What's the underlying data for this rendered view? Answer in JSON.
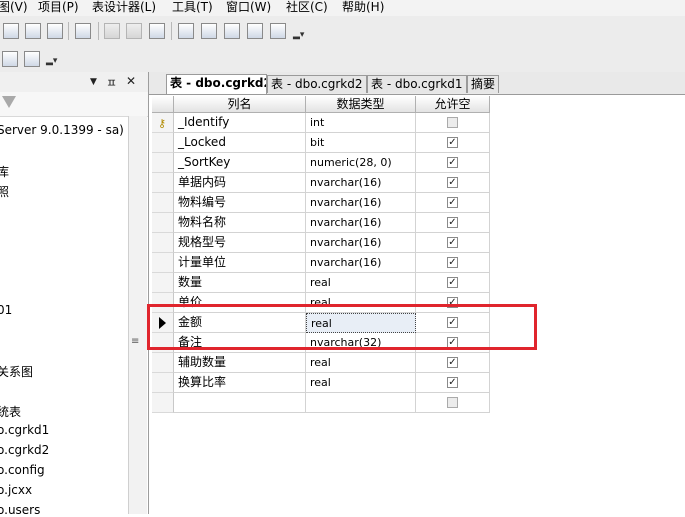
{
  "menubar": {
    "items": [
      "图(V)",
      "项目(P)",
      "表设计器(L)",
      "工具(T)",
      "窗口(W)",
      "社区(C)",
      "帮助(H)"
    ]
  },
  "left_panel": {
    "controls": {
      "dropdown": "▼",
      "pin": "ㅍ",
      "close": "✕"
    },
    "tree_items": [
      "Server 9.0.1399 - sa)",
      "库",
      "照",
      "01",
      "关系图",
      "统表",
      "o.cgrkd1",
      "o.cgrkd2",
      "o.config",
      "o.jcxx",
      "o.users"
    ]
  },
  "tabs": [
    "表 - dbo.cgrkd2",
    "表 - dbo.cgrkd2",
    "表 - dbo.cgrkd1",
    "摘要"
  ],
  "grid": {
    "headers": [
      "列名",
      "数据类型",
      "允许空"
    ],
    "rows": [
      {
        "name": "_Identify",
        "type": "int",
        "allow_null": false,
        "marker": "key"
      },
      {
        "name": "_Locked",
        "type": "bit",
        "allow_null": true,
        "marker": ""
      },
      {
        "name": "_SortKey",
        "type": "numeric(28, 0)",
        "allow_null": true,
        "marker": ""
      },
      {
        "name": "单据内码",
        "type": "nvarchar(16)",
        "allow_null": true,
        "marker": ""
      },
      {
        "name": "物料编号",
        "type": "nvarchar(16)",
        "allow_null": true,
        "marker": ""
      },
      {
        "name": "物料名称",
        "type": "nvarchar(16)",
        "allow_null": true,
        "marker": ""
      },
      {
        "name": "规格型号",
        "type": "nvarchar(16)",
        "allow_null": true,
        "marker": ""
      },
      {
        "name": "计量单位",
        "type": "nvarchar(16)",
        "allow_null": true,
        "marker": ""
      },
      {
        "name": "数量",
        "type": "real",
        "allow_null": true,
        "marker": ""
      },
      {
        "name": "单价",
        "type": "real",
        "allow_null": true,
        "marker": ""
      },
      {
        "name": "金额",
        "type": "real",
        "allow_null": true,
        "marker": "current"
      },
      {
        "name": "备注",
        "type": "nvarchar(32)",
        "allow_null": true,
        "marker": ""
      },
      {
        "name": "辅助数量",
        "type": "real",
        "allow_null": true,
        "marker": ""
      },
      {
        "name": "换算比率",
        "type": "real",
        "allow_null": true,
        "marker": ""
      },
      {
        "name": "",
        "type": "",
        "allow_null": false,
        "marker": ""
      }
    ]
  },
  "colors": {
    "highlight_box": "#e0252d"
  }
}
